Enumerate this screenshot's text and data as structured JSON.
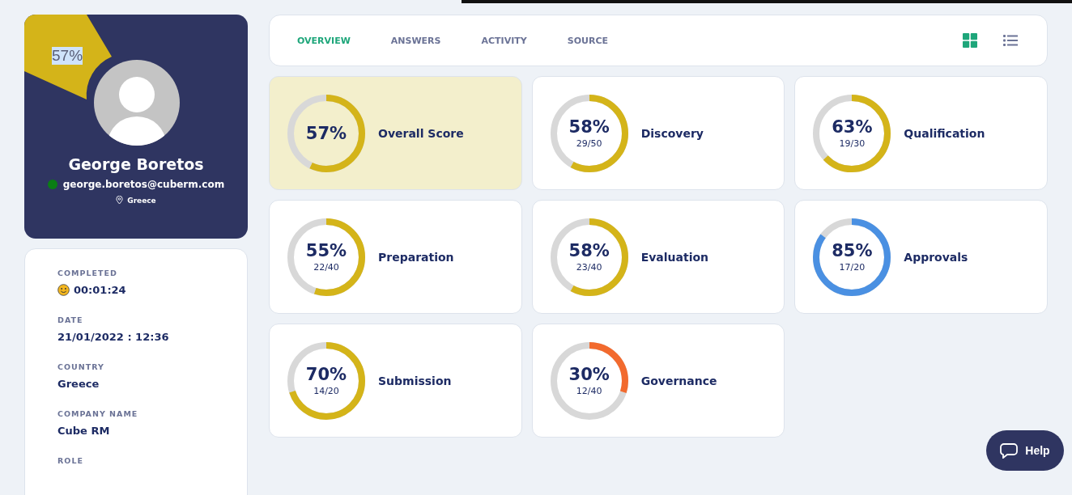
{
  "profile": {
    "score_badge": "57%",
    "name": "George Boretos",
    "online": true,
    "email": "george.boretos@cuberm.com",
    "location": "Greece"
  },
  "details": [
    {
      "label": "COMPLETED",
      "value": "00:01:24",
      "kind": "smiley"
    },
    {
      "label": "DATE",
      "value": "21/01/2022 : 12:36",
      "kind": "plain"
    },
    {
      "label": "COUNTRY",
      "value": "Greece",
      "kind": "plain"
    },
    {
      "label": "COMPANY NAME",
      "value": "Cube RM",
      "kind": "plain"
    },
    {
      "label": "ROLE"
    }
  ],
  "tabs": [
    {
      "label": "OVERVIEW",
      "selected": true
    },
    {
      "label": "ANSWERS",
      "selected": false
    },
    {
      "label": "ACTIVITY",
      "selected": false
    },
    {
      "label": "SOURCE",
      "selected": false
    }
  ],
  "view_toggle": [
    {
      "kind": "grid",
      "selected": true
    },
    {
      "kind": "list",
      "selected": false
    }
  ],
  "scores": [
    {
      "percent": "57%",
      "label": "Overall Score",
      "level": 0.57,
      "color": "#d4b419",
      "selected": true
    },
    {
      "percent": "58%",
      "fraction": "29/50",
      "label": "Discovery",
      "level": 0.58,
      "color": "#d4b419",
      "selected": false
    },
    {
      "percent": "63%",
      "fraction": "19/30",
      "label": "Qualification",
      "level": 0.63,
      "color": "#d4b419",
      "selected": false
    },
    {
      "percent": "55%",
      "fraction": "22/40",
      "label": "Preparation",
      "level": 0.55,
      "color": "#d4b419",
      "selected": false
    },
    {
      "percent": "58%",
      "fraction": "23/40",
      "label": "Evaluation",
      "level": 0.58,
      "color": "#d4b419",
      "selected": false
    },
    {
      "percent": "85%",
      "fraction": "17/20",
      "label": "Approvals",
      "level": 0.85,
      "color": "#4a90e2",
      "selected": false
    },
    {
      "percent": "70%",
      "fraction": "14/20",
      "label": "Submission",
      "level": 0.7,
      "color": "#d4b419",
      "selected": false
    },
    {
      "percent": "30%",
      "fraction": "12/40",
      "label": "Governance",
      "level": 0.3,
      "color": "#f26a2e",
      "selected": false
    }
  ],
  "help_button": {
    "label": "Help"
  }
}
